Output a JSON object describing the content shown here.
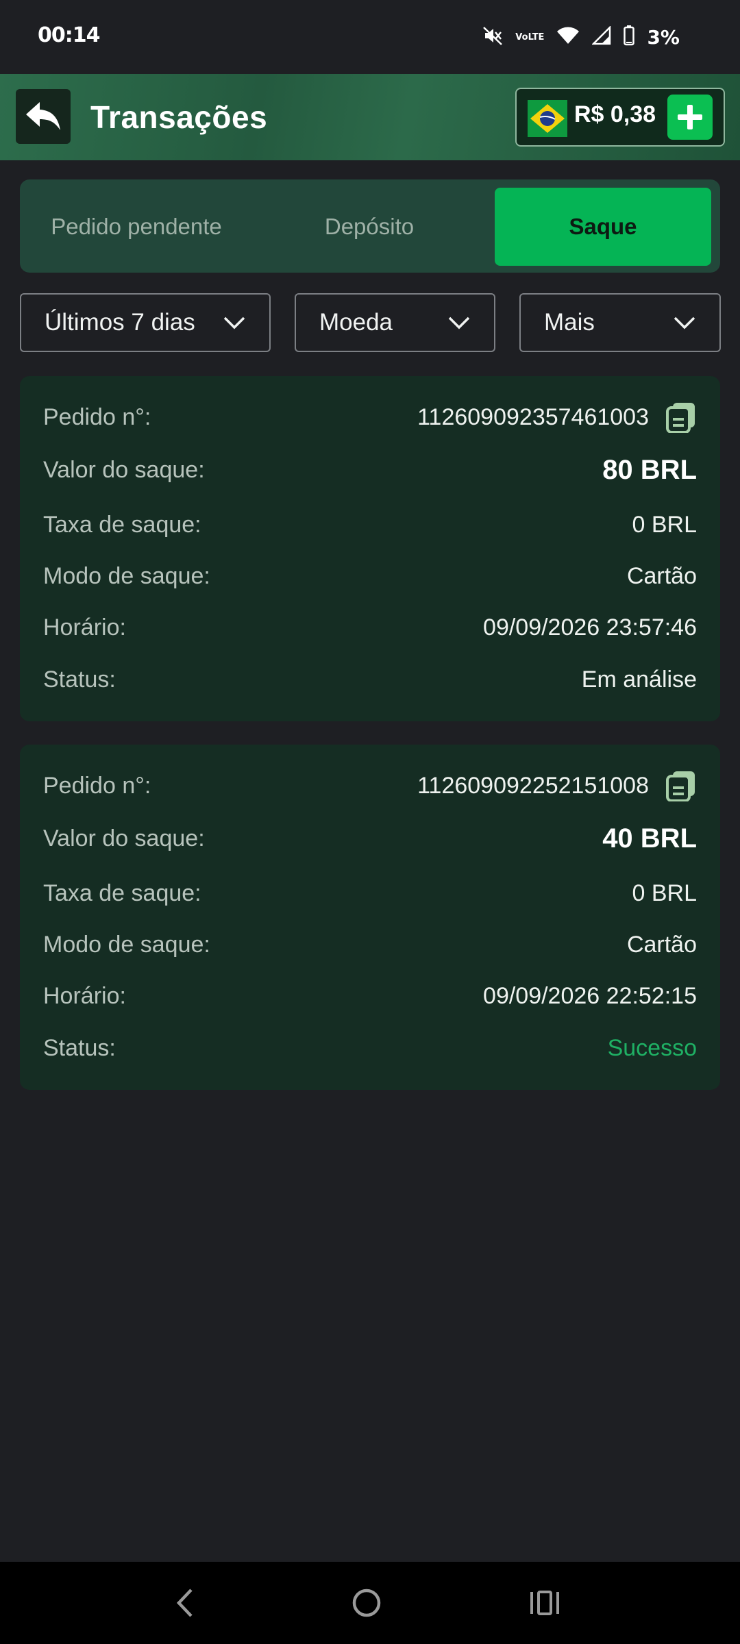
{
  "status_bar": {
    "time": "00:14",
    "volte_label": "VoLTE",
    "battery": "3%"
  },
  "header": {
    "title": "Transações",
    "balance": "R$ 0,38"
  },
  "tabs": [
    {
      "label": "Pedido pendente",
      "active": false
    },
    {
      "label": "Depósito",
      "active": false
    },
    {
      "label": "Saque",
      "active": true
    }
  ],
  "filters": {
    "period": "Últimos 7 dias",
    "currency": "Moeda",
    "more": "Mais"
  },
  "labels": {
    "order": "Pedido n°:",
    "amount": "Valor do saque:",
    "fee": "Taxa de saque:",
    "mode": "Modo de saque:",
    "time": "Horário:",
    "status": "Status:"
  },
  "transactions": [
    {
      "order": "112609092357461003",
      "amount": "80 BRL",
      "fee": "0 BRL",
      "mode": "Cartão",
      "time": "09/09/2026 23:57:46",
      "status": "Em análise"
    },
    {
      "order": "112609092252151008",
      "amount": "40 BRL",
      "fee": "0 BRL",
      "mode": "Cartão",
      "time": "09/09/2026 22:52:15",
      "status": "Sucesso"
    }
  ],
  "colors": {
    "accent": "#05b455",
    "success": "#1fb064",
    "card_bg": "#152d23"
  }
}
